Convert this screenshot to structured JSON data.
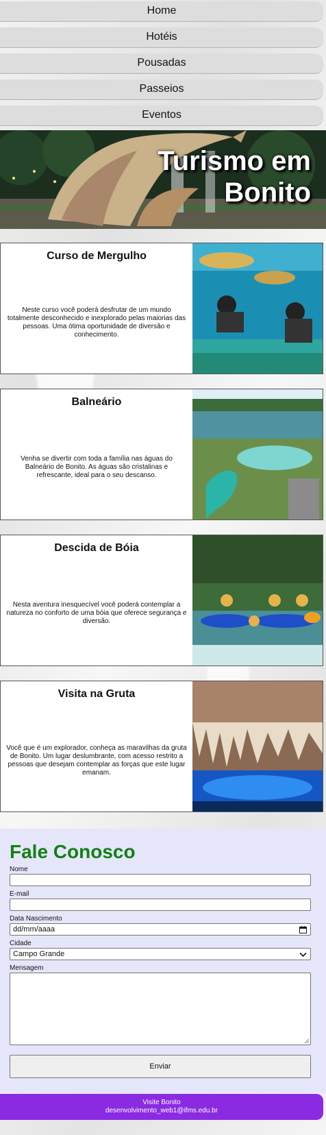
{
  "nav": {
    "items": [
      {
        "label": "Home"
      },
      {
        "label": "Hotéis"
      },
      {
        "label": "Pousadas"
      },
      {
        "label": "Passeios"
      },
      {
        "label": "Eventos"
      }
    ]
  },
  "hero": {
    "title_line1": "Turismo em",
    "title_line2": "Bonito"
  },
  "cards": [
    {
      "title": "Curso de Mergulho",
      "description": "Neste curso você poderá desfrutar de um mundo totalmente desconhecido e inexplorado pelas maiorias das pessoas. Uma ótima oportunidade de diversão e conhecimento."
    },
    {
      "title": "Balneário",
      "description": "Venha se divertir com toda a família nas águas do Balneário de Bonito. As águas são cristalinas e refrescante, ideal para o seu descanso."
    },
    {
      "title": "Descida de Bóia",
      "description": "Nesta aventura inesquecível você poderá contemplar a natureza no conforto de uma bóia que oferece segurança e diversão."
    },
    {
      "title": "Visita na Gruta",
      "description": "Você que é um explorador, conheça as maravilhas da gruta de Bonito. Um lugar deslumbrante, com acesso restrito a pessoas que desejam contemplar as forças que este lugar emanam."
    }
  ],
  "contact": {
    "title": "Fale Conosco",
    "name_label": "Nome",
    "email_label": "E-mail",
    "birth_label": "Data Nascimento",
    "birth_placeholder": "dd/mm/aaaa",
    "city_label": "Cidade",
    "city_value": "Campo Grande",
    "message_label": "Mensagem",
    "submit_label": "Enviar"
  },
  "footer": {
    "line1": "Visite Bonito",
    "line2": "desenvolvimento_web1@ifms.edu.br"
  },
  "colors": {
    "contact_title": "#138013",
    "contact_bg": "#e6e6fa",
    "footer_bg": "#8a2be2",
    "nav_bg": "#dddddd"
  }
}
